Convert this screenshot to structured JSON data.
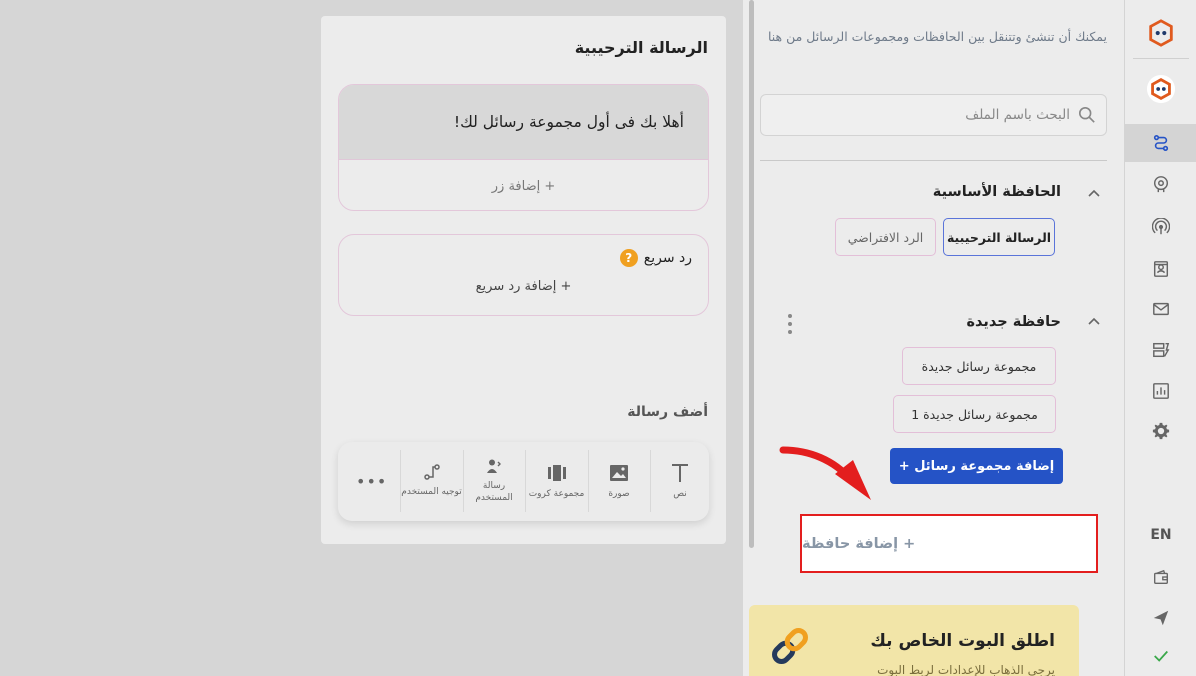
{
  "rail": {
    "items": [
      {
        "name": "bot-logo-icon"
      },
      {
        "name": "bot-avatar-icon"
      },
      {
        "name": "flow-icon",
        "active": true
      },
      {
        "name": "brain-icon"
      },
      {
        "name": "broadcast-icon"
      },
      {
        "name": "contact-card-icon"
      },
      {
        "name": "mail-icon"
      },
      {
        "name": "templates-icon"
      },
      {
        "name": "analytics-icon"
      },
      {
        "name": "settings-icon"
      }
    ],
    "language": "EN",
    "bottom": [
      {
        "name": "wallet-icon"
      },
      {
        "name": "send-icon"
      },
      {
        "name": "check-icon"
      }
    ],
    "colors": {
      "brand": "#e05a1e",
      "accent": "#2553c6",
      "check": "#3aa84a"
    }
  },
  "sidebar": {
    "hint": "يمكنك أن تنشئ وتتنقل بين الحافظات ومجموعات الرسائل من هنا",
    "search": {
      "placeholder": "البحث باسم الملف",
      "value": ""
    },
    "folders": [
      {
        "title": "الحافظة الأساسية",
        "items": [
          {
            "label": "الرسالة الترحيبية",
            "selected": true
          },
          {
            "label": "الرد الافتراضي",
            "selected": false
          }
        ]
      },
      {
        "title": "حافظة جديدة",
        "items": [
          {
            "label": "مجموعة رسائل جديدة"
          },
          {
            "label": "مجموعة رسائل جديدة 1"
          }
        ],
        "add_group_label": "إضافة مجموعة رسائل +"
      }
    ],
    "add_folder_label": "+ إضافة حافظة",
    "launch": {
      "title": "اطلق البوت الخاص بك",
      "subtitle": "يرجى الذهاب للإعدادات لربط البوت"
    }
  },
  "main": {
    "title": "الرسالة الترحيبية",
    "welcome_message": "أهلا بك فى أول مجموعة رسائل لك!",
    "add_button_label": "+ إضافة زر",
    "quick_reply": {
      "label": "رد سريع",
      "help_icon": "?",
      "add_label": "+ إضافة رد سريع"
    },
    "add_message_title": "أضف رسالة",
    "tools": [
      {
        "icon": "text-icon",
        "label": "نص"
      },
      {
        "icon": "image-icon",
        "label": "صورة"
      },
      {
        "icon": "cards-icon",
        "label": "مجموعة كروت"
      },
      {
        "icon": "user-message-icon",
        "label": "رسالة المستخدم"
      },
      {
        "icon": "route-icon",
        "label": "توجيه المستخدم"
      }
    ],
    "more_label": "•••"
  }
}
